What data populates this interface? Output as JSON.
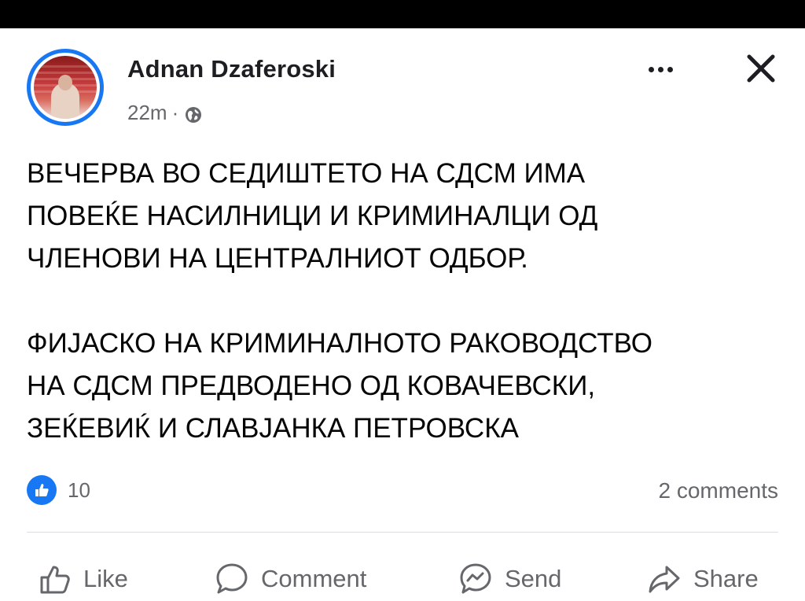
{
  "post": {
    "author": "Adnan Dzaferoski",
    "time": "22m",
    "separator": "·",
    "privacy_icon": "globe-icon",
    "paragraphs": [
      [
        "ВЕЧЕРВА ВО СЕДИШТЕТО НА СДСМ ИМА",
        "ПОВЕЌЕ НАСИЛНИЦИ И КРИМИНАЛЦИ ОД",
        "ЧЛЕНОВИ НА ЦЕНТРАЛНИОТ ОДБОР."
      ],
      [
        "ФИЈАСКО НА КРИМИНАЛНОТО РАКОВОДСТВО",
        "НА СДСМ ПРЕДВОДЕНО ОД КОВАЧЕВСКИ,",
        "ЗЕЌЕВИЌ И СЛАВЈАНКА ПЕТРОВСКА"
      ]
    ],
    "reactions": {
      "icon": "like-badge-icon",
      "count": "10"
    },
    "comments_count": "2 comments"
  },
  "actions": {
    "like": {
      "label": "Like",
      "icon": "thumbs-up-icon"
    },
    "comment": {
      "label": "Comment",
      "icon": "comment-bubble-icon"
    },
    "send": {
      "label": "Send",
      "icon": "messenger-icon"
    },
    "share": {
      "label": "Share",
      "icon": "share-arrow-icon"
    }
  },
  "colors": {
    "accent": "#1877f2",
    "text": "#050505",
    "secondary": "#65676b",
    "top_bar": "#000000"
  }
}
